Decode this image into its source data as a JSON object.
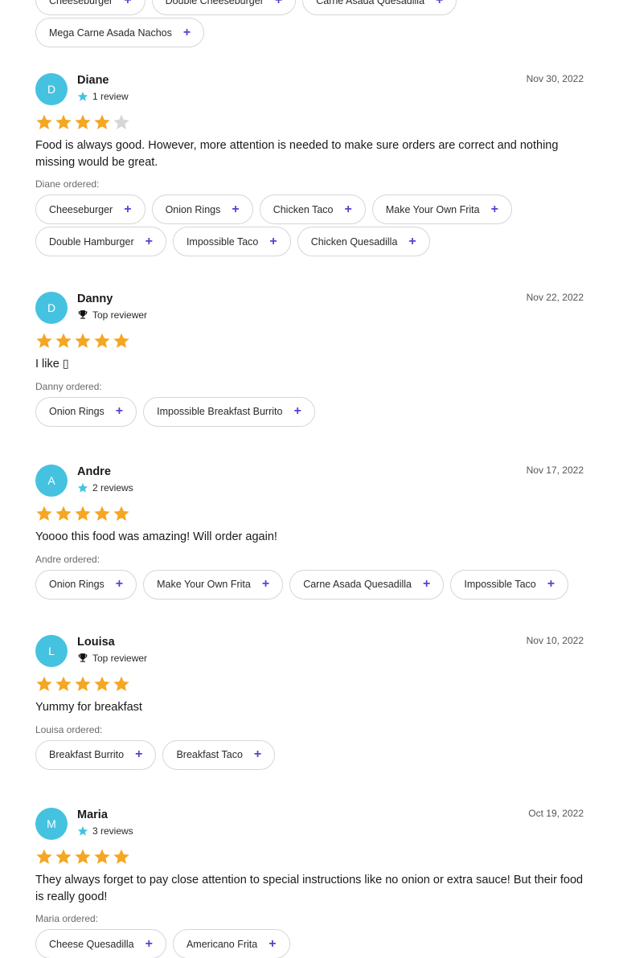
{
  "colors": {
    "accent": "#5a3fd0",
    "avatar": "#45c2e0",
    "star_filled": "#f5a623",
    "star_empty": "#d6d6d6",
    "review_star": "#45c2e0"
  },
  "icons": {
    "add": "plus-icon",
    "rating": "star-icon",
    "top_reviewer": "trophy-icon",
    "review_count": "star-icon"
  },
  "previous_order": {
    "items": [
      "Cheeseburger",
      "Double Cheeseburger",
      "Carne Asada Quesadilla",
      "Mega Carne Asada Nachos"
    ]
  },
  "reviews": [
    {
      "initial": "D",
      "name": "Diane",
      "badge": "1 review",
      "badge_type": "reviews",
      "date": "Nov 30, 2022",
      "rating": 4,
      "text": "Food is always good. However, more attention is needed to make sure orders are correct and nothing missing would be great.",
      "ordered_label": "Diane ordered:",
      "items": [
        "Cheeseburger",
        "Onion Rings",
        "Chicken Taco",
        "Make Your Own Frita",
        "Double Hamburger",
        "Impossible Taco",
        "Chicken Quesadilla"
      ]
    },
    {
      "initial": "D",
      "name": "Danny",
      "badge": "Top reviewer",
      "badge_type": "top",
      "date": "Nov 22, 2022",
      "rating": 5,
      "text": "I like ▯",
      "ordered_label": "Danny ordered:",
      "items": [
        "Onion Rings",
        "Impossible Breakfast Burrito"
      ]
    },
    {
      "initial": "A",
      "name": "Andre",
      "badge": "2 reviews",
      "badge_type": "reviews",
      "date": "Nov 17, 2022",
      "rating": 5,
      "text": "Yoooo this food was amazing! Will order again!",
      "ordered_label": "Andre ordered:",
      "items": [
        "Onion Rings",
        "Make Your Own Frita",
        "Carne Asada Quesadilla",
        "Impossible Taco"
      ]
    },
    {
      "initial": "L",
      "name": "Louisa",
      "badge": "Top reviewer",
      "badge_type": "top",
      "date": "Nov 10, 2022",
      "rating": 5,
      "text": "Yummy for breakfast",
      "ordered_label": "Louisa ordered:",
      "items": [
        "Breakfast Burrito",
        "Breakfast Taco"
      ]
    },
    {
      "initial": "M",
      "name": "Maria",
      "badge": "3 reviews",
      "badge_type": "reviews",
      "date": "Oct 19, 2022",
      "rating": 5,
      "text": "They always forget to pay close attention to special instructions like no onion or extra sauce! But their food is really good!",
      "ordered_label": "Maria ordered:",
      "items": [
        "Cheese Quesadilla",
        "Americano Frita"
      ]
    }
  ]
}
